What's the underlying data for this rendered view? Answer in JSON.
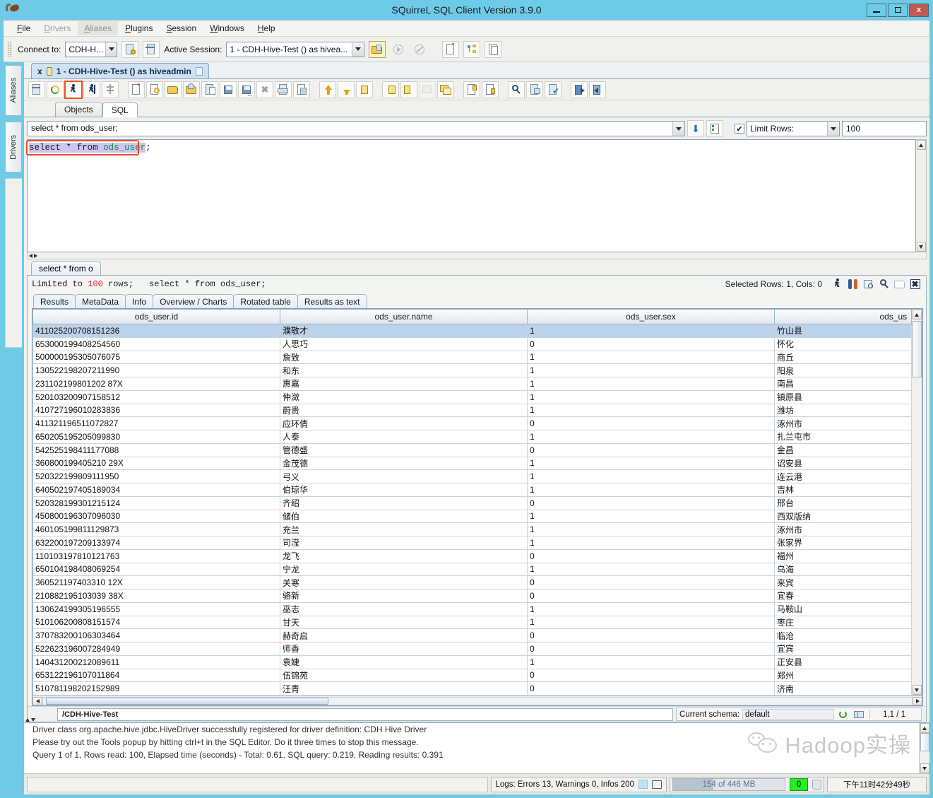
{
  "window": {
    "title": "SQuirreL SQL Client Version 3.9.0",
    "app_icon": "squirrel-icon",
    "minimize": "–",
    "maximize": "□",
    "close": "x"
  },
  "menubar": [
    {
      "label": "File",
      "state": "normal"
    },
    {
      "label": "Drivers",
      "state": "disabled"
    },
    {
      "label": "Aliases",
      "state": "highlighted"
    },
    {
      "label": "Plugins",
      "state": "normal"
    },
    {
      "label": "Session",
      "state": "normal"
    },
    {
      "label": "Windows",
      "state": "normal"
    },
    {
      "label": "Help",
      "state": "normal"
    }
  ],
  "connect_bar": {
    "connect_label": "Connect to:",
    "alias_value": "CDH-H...",
    "active_session_label": "Active Session:",
    "session_value": "1 - CDH-Hive-Test () as hivea...",
    "buttons": [
      "connect-alias-icon",
      "new-session-icon",
      "commit-icon",
      "run-session-icon",
      "stop-session-icon",
      "new-sql-tab-icon",
      "session-tree-icon",
      "copy-session-icon"
    ]
  },
  "left_rail": {
    "tabs": [
      "Aliases",
      "Drivers"
    ]
  },
  "session_tab": {
    "close": "x",
    "label": "1 - CDH-Hive-Test () as hiveadmin"
  },
  "sql_toolbar": {
    "icons": [
      "execute-sql-editor-icon",
      "refresh-icon",
      "run-sql-icon",
      "run-current-sql-icon",
      "format-sql-icon",
      "new-file-icon",
      "new-sql-icon",
      "open-file-icon",
      "append-file-icon",
      "paste-icon",
      "save-icon",
      "save-as-icon",
      "close-icon",
      "print-icon",
      "preview-icon",
      "move-up-icon",
      "move-down-icon",
      "list-icon",
      "split-left-icon",
      "split-right-icon",
      "tile-icon",
      "cascade-icon",
      "add-col-icon",
      "remove-col-icon",
      "find-icon",
      "edit-icon",
      "validate-icon",
      "import-icon",
      "export-icon"
    ],
    "highlighted_index": 2
  },
  "editor_tabs": [
    {
      "label": "Objects",
      "active": false
    },
    {
      "label": "SQL",
      "active": true
    }
  ],
  "sql_bar": {
    "history_value": "select * from ods_user;",
    "limit_checkbox": "✔",
    "limit_label": "Limit Rows:",
    "limit_value": "100"
  },
  "sql_editor": {
    "tokens": {
      "keyword1": "select",
      "star": "*",
      "keyword2": "from",
      "table": "ods_user",
      "semi": ";"
    },
    "full_text": "select * from ods_user;",
    "annotation": "red-highlight-box"
  },
  "result_tab": {
    "label": "select * from o"
  },
  "result_header": {
    "limited_prefix": "Limited to",
    "limited_count": "100",
    "limited_suffix": "rows;",
    "query": "select * from ods_user;",
    "selected_info": "Selected Rows: 1, Cols: 0",
    "tool_icons": [
      "run-icon",
      "people-icon",
      "table-properties-icon",
      "search-icon",
      "copy-icon",
      "close-results-icon"
    ]
  },
  "result_tabs": [
    {
      "label": "Results",
      "active": true
    },
    {
      "label": "MetaData",
      "active": false
    },
    {
      "label": "Info",
      "active": false
    },
    {
      "label": "Overview / Charts",
      "active": false
    },
    {
      "label": "Rotated table",
      "active": false
    },
    {
      "label": "Results as text",
      "active": false
    }
  ],
  "table": {
    "columns": [
      "ods_user.id",
      "ods_user.name",
      "ods_user.sex",
      "ods_us"
    ],
    "rows": [
      {
        "id": "411025200708151236",
        "name": "濮敬才",
        "sex": "1",
        "city": "竹山县",
        "selected": true
      },
      {
        "id": "653000199408254560",
        "name": "人思巧",
        "sex": "0",
        "city": "怀化",
        "selected": false
      },
      {
        "id": "500000195305076075",
        "name": "詹致",
        "sex": "1",
        "city": "商丘",
        "selected": false
      },
      {
        "id": "130522198207211990",
        "name": "和东",
        "sex": "1",
        "city": "阳泉",
        "selected": false
      },
      {
        "id": "231102199801202 87X",
        "name": "惠嘉",
        "sex": "1",
        "city": "南昌",
        "selected": false
      },
      {
        "id": "520103200907158512",
        "name": "仲潋",
        "sex": "1",
        "city": "镇原县",
        "selected": false
      },
      {
        "id": "410727196010283836",
        "name": "蔚贵",
        "sex": "1",
        "city": "潍坊",
        "selected": false
      },
      {
        "id": "411321196511072827",
        "name": "应环倩",
        "sex": "0",
        "city": "涿州市",
        "selected": false
      },
      {
        "id": "650205195205099830",
        "name": "人泰",
        "sex": "1",
        "city": "扎兰屯市",
        "selected": false
      },
      {
        "id": "542525198411177088",
        "name": "管德盛",
        "sex": "0",
        "city": "金昌",
        "selected": false
      },
      {
        "id": "360800199405210 29X",
        "name": "金茂德",
        "sex": "1",
        "city": "诏安县",
        "selected": false
      },
      {
        "id": "520322199809111950",
        "name": "弓义",
        "sex": "1",
        "city": "连云港",
        "selected": false
      },
      {
        "id": "640502197405189034",
        "name": "伯琼华",
        "sex": "1",
        "city": "吉林",
        "selected": false
      },
      {
        "id": "520328199301215124",
        "name": "齐绍",
        "sex": "0",
        "city": "邢台",
        "selected": false
      },
      {
        "id": "450800196307096030",
        "name": "储伯",
        "sex": "1",
        "city": "西双版纳",
        "selected": false
      },
      {
        "id": "460105199811129873",
        "name": "充兰",
        "sex": "1",
        "city": "涿州市",
        "selected": false
      },
      {
        "id": "632200197209133974",
        "name": "司滢",
        "sex": "1",
        "city": "张家界",
        "selected": false
      },
      {
        "id": "110103197810121763",
        "name": "龙飞",
        "sex": "0",
        "city": "福州",
        "selected": false
      },
      {
        "id": "650104198408069254",
        "name": "宁龙",
        "sex": "1",
        "city": "乌海",
        "selected": false
      },
      {
        "id": "360521197403310 12X",
        "name": "关寒",
        "sex": "0",
        "city": "来宾",
        "selected": false
      },
      {
        "id": "210882195103039 38X",
        "name": "骆新",
        "sex": "0",
        "city": "宜春",
        "selected": false
      },
      {
        "id": "130624199305196555",
        "name": "巫志",
        "sex": "1",
        "city": "马鞍山",
        "selected": false
      },
      {
        "id": "510106200808151574",
        "name": "甘天",
        "sex": "1",
        "city": "枣庄",
        "selected": false
      },
      {
        "id": "370783200106303464",
        "name": "赫奇启",
        "sex": "0",
        "city": "临沧",
        "selected": false
      },
      {
        "id": "522623196007284949",
        "name": "师香",
        "sex": "0",
        "city": "宜宾",
        "selected": false
      },
      {
        "id": "140431200212089611",
        "name": "袁婕",
        "sex": "1",
        "city": "正安县",
        "selected": false
      },
      {
        "id": "653122196107011864",
        "name": "伍锦苑",
        "sex": "0",
        "city": "郑州",
        "selected": false
      },
      {
        "id": "510781198202152989",
        "name": "汪青",
        "sex": "0",
        "city": "济南",
        "selected": false
      }
    ]
  },
  "schema_bar": {
    "path": "/CDH-Hive-Test",
    "current_schema_label": "Current schema:",
    "current_schema_value": "default",
    "position": "1,1 / 1",
    "icons": [
      "refresh-schema-icon",
      "schema-table-icon"
    ]
  },
  "log": {
    "lines": [
      {
        "text": "Driver class org.apache.hive.jdbc.HiveDriver successfully registered for driver definition: CDH Hive Driver",
        "highlight": false
      },
      {
        "text": "Please try out the Tools popup by hitting ctrl+t in the SQL Editor. Do it three times to stop this message.",
        "highlight": false
      },
      {
        "text": "Query 1 of 1, Rows read: 100, Elapsed time (seconds) - Total: 0.61, SQL query: 0.219, Reading results: 0.391",
        "highlight": true
      }
    ],
    "watermark": "Hadoop实操"
  },
  "status_bar": {
    "logs": "Logs: Errors 13, Warnings 0, Infos 200",
    "memory": "154 of 446 MB",
    "gc_count": "0",
    "time": "下午11时42分49秒"
  },
  "colors": {
    "titlebar": "#6ecbe8",
    "accent_red": "#f04d23",
    "highlight_green": "#22ee22",
    "selection_blue": "#bcd2e8",
    "close_red": "#c25a52"
  }
}
